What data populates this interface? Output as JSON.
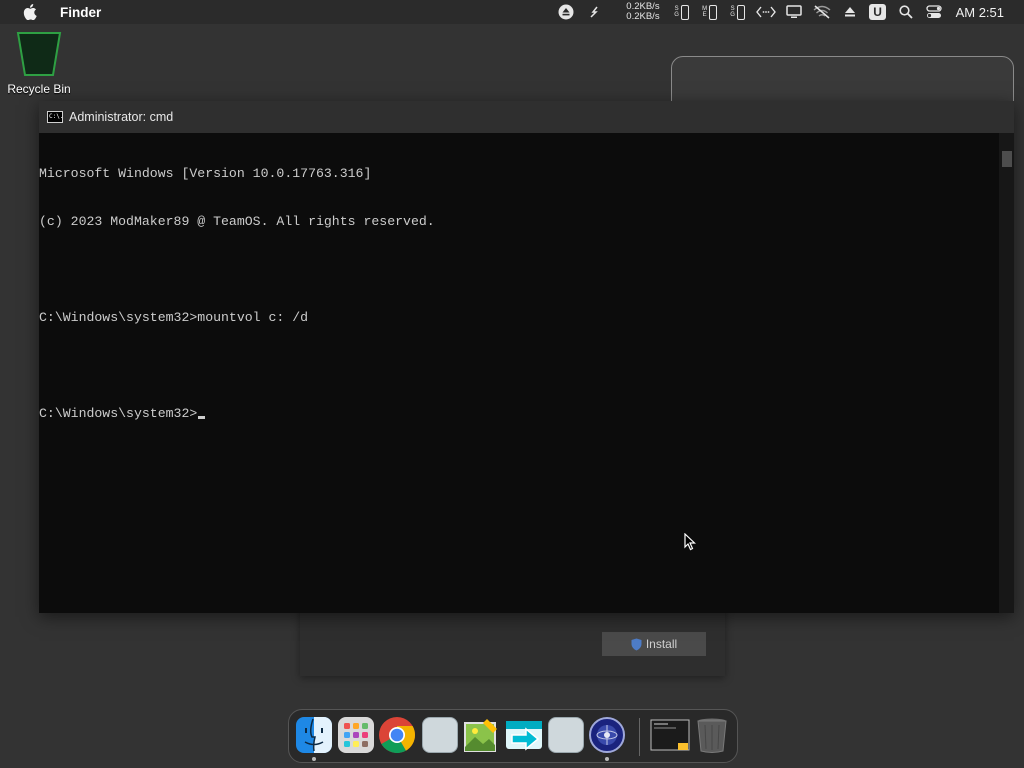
{
  "menubar": {
    "app_name": "Finder",
    "net_up": "0.2KB/s",
    "net_down": "0.2KB/s",
    "phone_tags": [
      "S\nG",
      "M\nE",
      "S\nG"
    ],
    "u_label": "U",
    "clock": "AM 2:51",
    "icons": [
      "apple-logo",
      "eject-circle",
      "refresh",
      "phone",
      "phone",
      "phone",
      "code-brackets",
      "display",
      "wifi-off",
      "eject",
      "u-badge",
      "search",
      "control-center"
    ]
  },
  "desktop": {
    "recycle_bin_label": "Recycle Bin"
  },
  "cmd": {
    "title": "Administrator: cmd",
    "icon_text": "C:\\.",
    "lines": [
      "Microsoft Windows [Version 10.0.17763.316]",
      "(c) 2023 ModMaker89 @ TeamOS. All rights reserved.",
      "",
      "C:\\Windows\\system32>mountvol c: /d",
      "",
      "C:\\Windows\\system32>"
    ]
  },
  "installer": {
    "install_label": "Install"
  },
  "dock": {
    "apps": [
      "Finder",
      "Launchpad",
      "Google Chrome",
      "Blank App",
      "Image Editor",
      "Migration Assistant",
      "Blank App",
      "Network Utility",
      "Screenshot",
      "Trash"
    ]
  },
  "colors": {
    "accent_recycle": "#2ea043",
    "terminal_bg": "#0c0c0c",
    "terminal_text": "#cccccc",
    "install_shield": "#4d7cc7"
  }
}
